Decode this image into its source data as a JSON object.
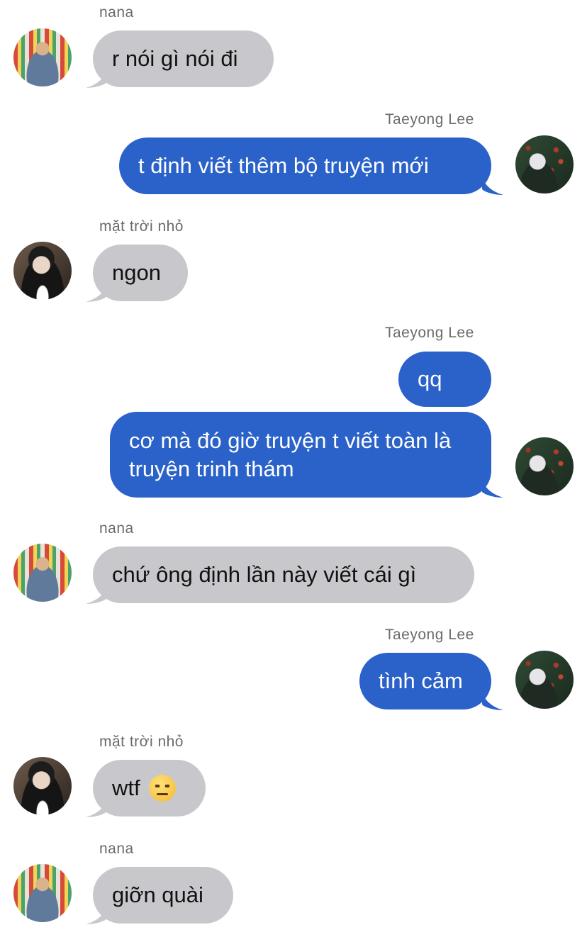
{
  "conversation": {
    "messages": [
      {
        "sender": "nana",
        "text": "r nói gì nói đi"
      },
      {
        "sender": "Taeyong Lee",
        "text": "t định viết thêm bộ truyện mới"
      },
      {
        "sender": "mặt trời nhỏ",
        "text": "ngon"
      },
      {
        "sender": "Taeyong Lee",
        "text": "qq"
      },
      {
        "text": "cơ mà đó giờ truyện t viết toàn là truyện trinh thám"
      },
      {
        "sender": "nana",
        "text": "chứ ông định lần này viết cái gì"
      },
      {
        "sender": "Taeyong Lee",
        "text": "tình cảm"
      },
      {
        "sender": "mặt trời nhỏ",
        "text": "wtf",
        "emoji": "raised-eyebrow-emoji"
      },
      {
        "sender": "nana",
        "text": "giỡn quài"
      }
    ]
  },
  "colors": {
    "incoming_bubble": "#c8c8cc",
    "outgoing_bubble": "#2a62c9",
    "sender_label": "#6b6b6b"
  }
}
